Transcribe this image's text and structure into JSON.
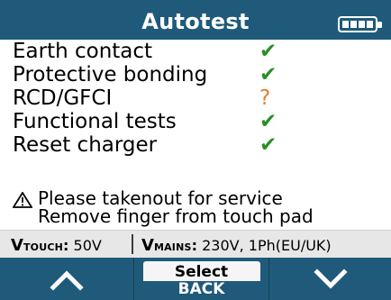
{
  "header": {
    "title": "Autotest"
  },
  "checks": [
    {
      "label": "Earth contact",
      "status": "✔",
      "status_type": "pass"
    },
    {
      "label": "Protective bonding",
      "status": "✔",
      "status_type": "pass"
    },
    {
      "label": "RCD/GFCI",
      "status": "?",
      "status_type": "unknown"
    },
    {
      "label": "Functional tests",
      "status": "✔",
      "status_type": "pass"
    },
    {
      "label": "Reset charger",
      "status": "✔",
      "status_type": "pass"
    }
  ],
  "notice": {
    "line1": "Please takenout for service",
    "line2": "Remove finger from touch pad"
  },
  "info_bar": {
    "touch_prefix": "V",
    "touch_sub": "TOUCH",
    "touch_value": "50V",
    "mains_prefix": "V",
    "mains_sub": "MAINS",
    "mains_value": "230V, 1Ph(EU/UK)"
  },
  "softkeys": {
    "select_top": "Select",
    "select_bottom": "BACK"
  },
  "colors": {
    "header_bg": "#1f5a7a",
    "pass": "#2a8d2a",
    "unknown": "#e57a2a"
  },
  "icons": {
    "battery": "battery-full-icon",
    "warning": "warning-triangle-icon",
    "up": "chevron-up-icon",
    "down": "chevron-down-icon"
  }
}
